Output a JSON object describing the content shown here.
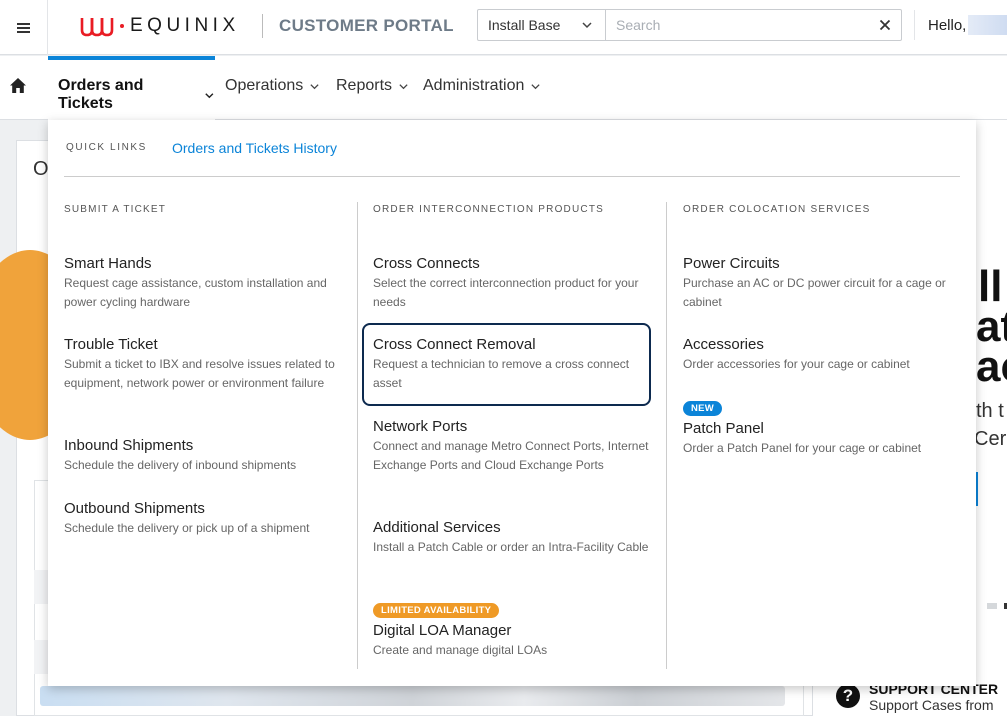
{
  "header": {
    "brand": "EQUINIX",
    "portal_title": "CUSTOMER PORTAL",
    "search_scope": "Install Base",
    "search_placeholder": "Search",
    "greeting": "Hello,"
  },
  "nav": {
    "items": [
      {
        "label": "Orders and Tickets",
        "active": true
      },
      {
        "label": "Operations"
      },
      {
        "label": "Reports"
      },
      {
        "label": "Administration"
      }
    ]
  },
  "background": {
    "page_heading_fragment": "O",
    "side_fragments": [
      "ll",
      "at",
      "ac",
      "th t",
      "Cer"
    ],
    "support_title": "SUPPORT CENTER",
    "support_subtitle": "Support Cases from"
  },
  "mega_menu": {
    "quick_links_label": "QUICK LINKS",
    "quick_links": [
      "Orders and Tickets History"
    ],
    "columns": [
      {
        "heading": "SUBMIT A TICKET",
        "entries": [
          {
            "title": "Smart Hands",
            "desc": "Request cage assistance, custom installation and power cycling hardware"
          },
          {
            "title": "Trouble Ticket",
            "desc": "Submit a ticket to IBX and resolve issues related to equipment, network power or environment failure"
          },
          {
            "title": "Inbound Shipments",
            "desc": "Schedule the delivery of inbound shipments"
          },
          {
            "title": "Outbound Shipments",
            "desc": "Schedule the delivery or pick up of a shipment"
          }
        ]
      },
      {
        "heading": "ORDER INTERCONNECTION PRODUCTS",
        "entries": [
          {
            "title": "Cross Connects",
            "desc": "Select the correct interconnection product for your needs"
          },
          {
            "title": "Cross Connect Removal",
            "desc": "Request a technician to remove a cross connect asset",
            "highlighted": true
          },
          {
            "title": "Network Ports",
            "desc": "Connect and manage Metro Connect Ports, Internet Exchange Ports and Cloud Exchange Ports"
          },
          {
            "title": "Additional Services",
            "desc": "Install a Patch Cable or order an Intra-Facility Cable"
          },
          {
            "title": "Digital LOA Manager",
            "desc": "Create and manage digital LOAs",
            "badge": "LIMITED AVAILABILITY"
          }
        ]
      },
      {
        "heading": "ORDER COLOCATION SERVICES",
        "entries": [
          {
            "title": "Power Circuits",
            "desc": "Purchase an AC or DC power circuit for a cage or cabinet"
          },
          {
            "title": "Accessories",
            "desc": "Order accessories for your cage or cabinet"
          },
          {
            "title": "Patch Panel",
            "desc": "Order a Patch Panel for your cage or cabinet",
            "badge": "NEW"
          }
        ]
      }
    ]
  },
  "colors": {
    "brand_red": "#e91c24",
    "accent_blue": "#0b84d8",
    "highlight_border": "#0d2a4f",
    "badge_orange": "#ef9a26"
  }
}
